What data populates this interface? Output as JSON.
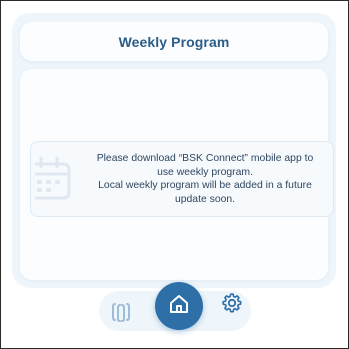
{
  "header": {
    "title": "Weekly Program"
  },
  "notice": {
    "icon": "calendar-icon",
    "lines": [
      "Please download “BSK Connect” mobile app to",
      "use weekly program.",
      "Local weekly program will be added in a future",
      "update soon."
    ]
  },
  "bottom_nav": {
    "items": [
      {
        "icon": "radiator-icon"
      },
      {
        "icon": "home-icon",
        "active": true
      },
      {
        "icon": "gear-icon"
      }
    ]
  },
  "colors": {
    "accent": "#2f6fa8",
    "title_text": "#2d5d86",
    "panel_background": "#eef5fb",
    "card_background": "#fbfdff",
    "body_text": "#2f4660"
  }
}
